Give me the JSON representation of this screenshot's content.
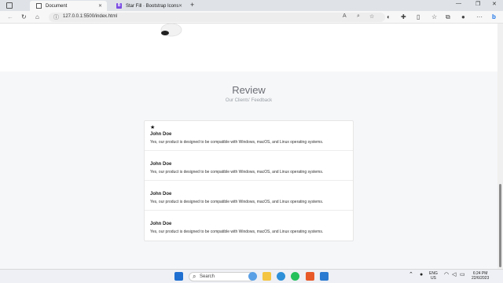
{
  "browser": {
    "tabs": [
      {
        "title": "Document",
        "active": true
      },
      {
        "title": "Star Fill · Bootstrap Icons",
        "active": false
      }
    ],
    "address": "127.0.0.1:5500/index.html"
  },
  "review": {
    "title": "Review",
    "subtitle": "Our Clients' Feedback",
    "items": [
      {
        "name": "John Doe",
        "text": "Yes, our product is designed to be compatible with Windows, macOS, and Linux operating systems."
      },
      {
        "name": "John Doe",
        "text": "Yes, our product is designed to be compatible with Windows, macOS, and Linux operating systems."
      },
      {
        "name": "John Doe",
        "text": "Yes, our product is designed to be compatible with Windows, macOS, and Linux operating systems."
      },
      {
        "name": "John Doe",
        "text": "Yes, our product is designed to be compatible with Windows, macOS, and Linux operating systems."
      }
    ]
  },
  "taskbar": {
    "search_label": "Search",
    "lang_line1": "ENG",
    "lang_line2": "US",
    "time": "6:24 PM",
    "date": "22/6/2023"
  },
  "icons": {
    "star": "star-fill-icon"
  }
}
